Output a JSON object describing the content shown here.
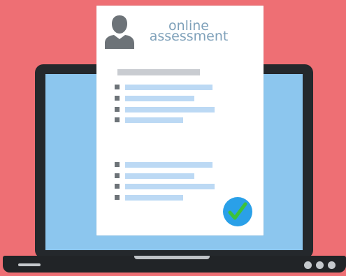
{
  "document": {
    "title_line_1": "online",
    "title_line_2": "assessment"
  },
  "icons": {
    "avatar": "user-silhouette-icon",
    "status": "checkmark-icon",
    "laptop_dots": [
      "dot-icon",
      "dot-icon",
      "dot-icon"
    ]
  },
  "colors": {
    "background": "#ee6f74",
    "laptop_body": "#24282c",
    "screen": "#8cc6ee",
    "paper": "#ffffff",
    "title_text": "#7fa1ba",
    "list_bullet": "#6d7378",
    "list_line": "#bcd9f4",
    "heading_bar": "#c9ccd1",
    "check_circle": "#2aa0e8",
    "check_mark": "#3cc23a"
  }
}
